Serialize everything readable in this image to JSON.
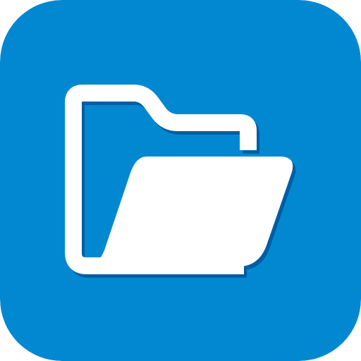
{
  "icon": {
    "name": "folder-open-icon",
    "background_color": "#0288D1",
    "glyph_color": "#FFFFFF",
    "shadow_color": "#01579B"
  }
}
